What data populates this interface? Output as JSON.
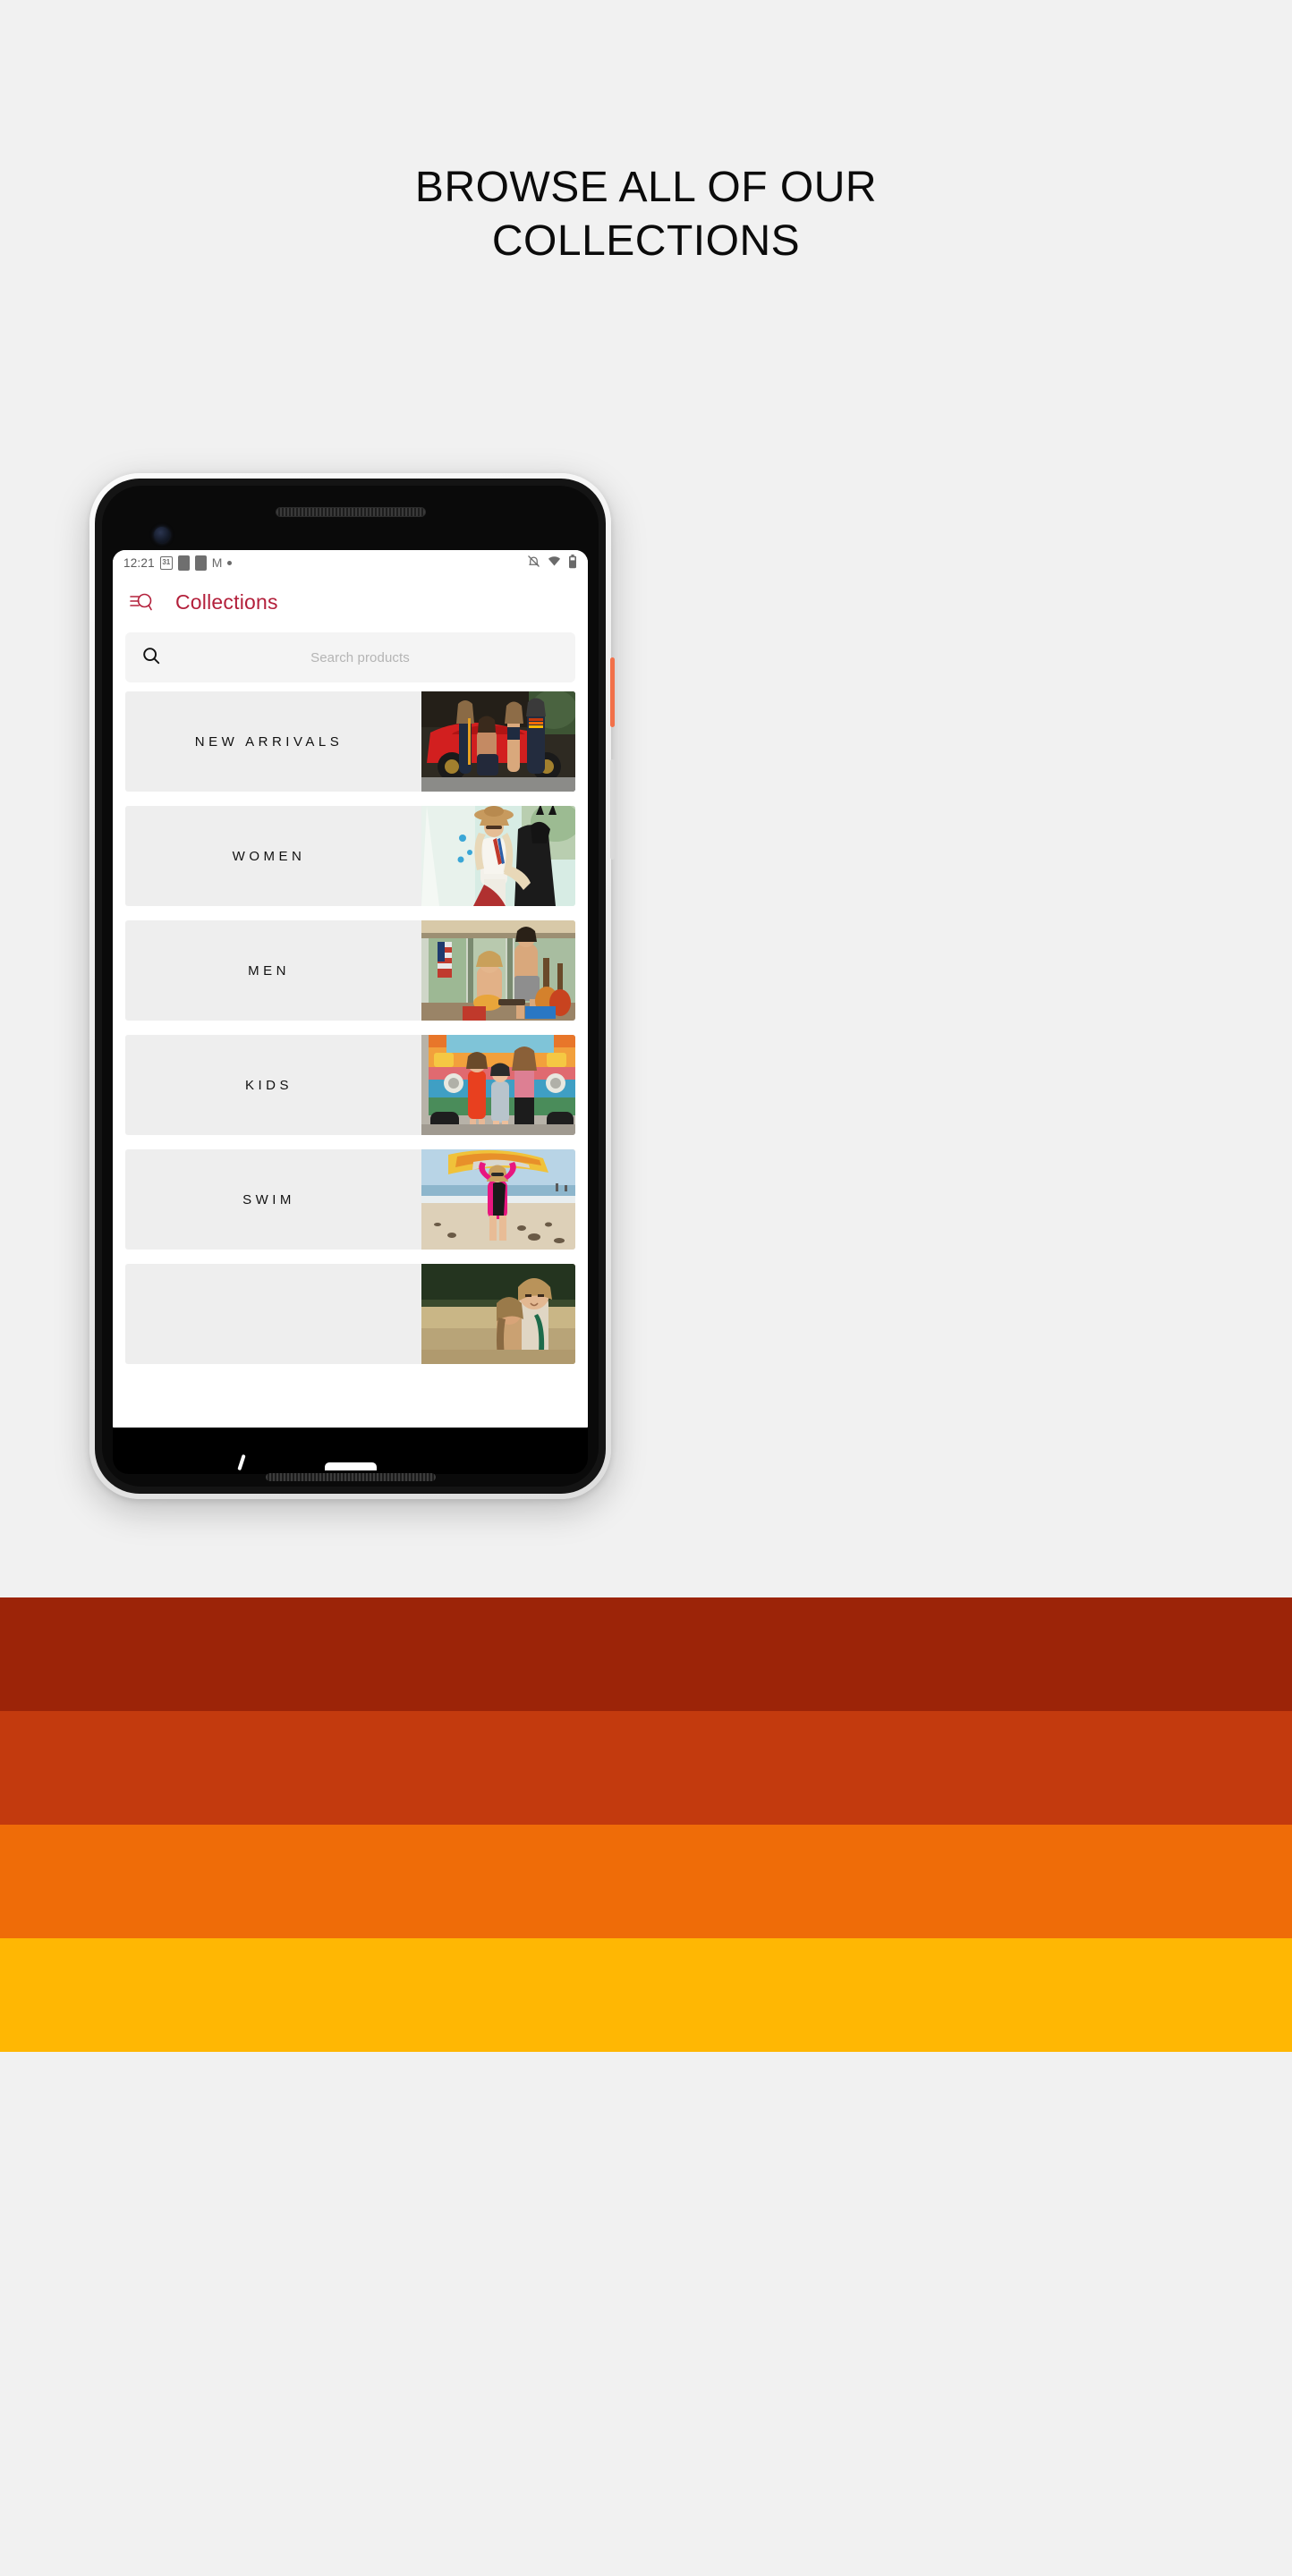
{
  "page": {
    "heading_line1": "BROWSE ALL OF OUR",
    "heading_line2": "COLLECTIONS",
    "background_color": "#f1f1f1"
  },
  "decor": {
    "stripes": [
      {
        "name": "stripe-dark-red",
        "color": "#9c2408"
      },
      {
        "name": "stripe-red-orange",
        "color": "#c33a0e"
      },
      {
        "name": "stripe-orange",
        "color": "#ef6c08"
      },
      {
        "name": "stripe-amber",
        "color": "#ffb703"
      }
    ]
  },
  "device": {
    "hardware": {
      "power_button_color": "#f2714a",
      "volume_button_color": "#d9d9d9"
    },
    "status_bar": {
      "time": "12:21",
      "calendar_day": "31",
      "icons_left": [
        "calendar-icon",
        "app-icon",
        "app-icon",
        "gmail-icon",
        "dot-icon"
      ],
      "gmail_glyph": "M",
      "icons_right": [
        "notifications-off-icon",
        "wifi-icon",
        "battery-icon"
      ]
    },
    "navigation_bar": {
      "gesture_pill": "home-pill",
      "back_hint": "back-gesture-hint"
    }
  },
  "app": {
    "header": {
      "title": "Collections",
      "title_color": "#b3203b",
      "menu_icon": "menu-search-icon"
    },
    "search": {
      "placeholder": "Search products",
      "value": "",
      "icon": "search-icon"
    },
    "collections": [
      {
        "label": "NEW ARRIVALS",
        "image": "group-by-red-sports-car"
      },
      {
        "label": "WOMEN",
        "image": "woman-on-horse-with-hat"
      },
      {
        "label": "MEN",
        "image": "two-men-with-guitars-on-porch"
      },
      {
        "label": "KIDS",
        "image": "three-kids-by-colorful-van"
      },
      {
        "label": "SWIM",
        "image": "woman-carrying-surfboard-on-beach"
      },
      {
        "label": "",
        "image": "couple-in-field-partial"
      }
    ]
  }
}
